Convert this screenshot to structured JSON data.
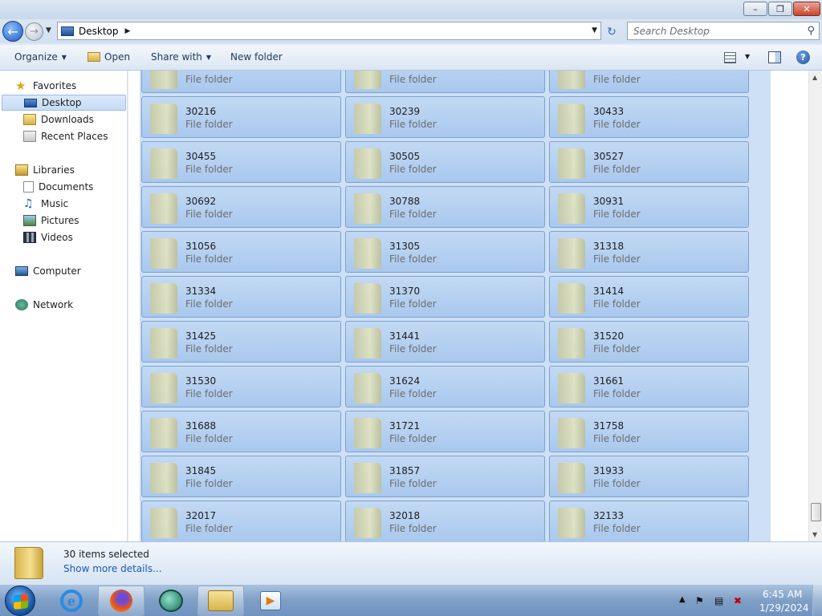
{
  "window": {
    "minimize_icon": "minimize-icon",
    "maximize_icon": "restore-icon",
    "close_icon": "close-icon"
  },
  "address": {
    "location": "Desktop",
    "search_placeholder": "Search Desktop"
  },
  "toolbar": {
    "organize": "Organize",
    "open": "Open",
    "share_with": "Share with",
    "new_folder": "New folder"
  },
  "nav": {
    "favorites": "Favorites",
    "desktop": "Desktop",
    "downloads": "Downloads",
    "recent_places": "Recent Places",
    "libraries": "Libraries",
    "documents": "Documents",
    "music": "Music",
    "pictures": "Pictures",
    "videos": "Videos",
    "computer": "Computer",
    "network": "Network"
  },
  "folder_type_label": "File folder",
  "items": [
    {
      "name": "",
      "type": "File folder"
    },
    {
      "name": "",
      "type": "File folder"
    },
    {
      "name": "",
      "type": "File folder"
    },
    {
      "name": "30216",
      "type": "File folder"
    },
    {
      "name": "30239",
      "type": "File folder"
    },
    {
      "name": "30433",
      "type": "File folder"
    },
    {
      "name": "30455",
      "type": "File folder"
    },
    {
      "name": "30505",
      "type": "File folder"
    },
    {
      "name": "30527",
      "type": "File folder"
    },
    {
      "name": "30692",
      "type": "File folder"
    },
    {
      "name": "30788",
      "type": "File folder"
    },
    {
      "name": "30931",
      "type": "File folder"
    },
    {
      "name": "31056",
      "type": "File folder"
    },
    {
      "name": "31305",
      "type": "File folder"
    },
    {
      "name": "31318",
      "type": "File folder"
    },
    {
      "name": "31334",
      "type": "File folder"
    },
    {
      "name": "31370",
      "type": "File folder"
    },
    {
      "name": "31414",
      "type": "File folder"
    },
    {
      "name": "31425",
      "type": "File folder"
    },
    {
      "name": "31441",
      "type": "File folder"
    },
    {
      "name": "31520",
      "type": "File folder"
    },
    {
      "name": "31530",
      "type": "File folder"
    },
    {
      "name": "31624",
      "type": "File folder"
    },
    {
      "name": "31661",
      "type": "File folder"
    },
    {
      "name": "31688",
      "type": "File folder"
    },
    {
      "name": "31721",
      "type": "File folder"
    },
    {
      "name": "31758",
      "type": "File folder"
    },
    {
      "name": "31845",
      "type": "File folder"
    },
    {
      "name": "31857",
      "type": "File folder"
    },
    {
      "name": "31933",
      "type": "File folder"
    },
    {
      "name": "32017",
      "type": "File folder"
    },
    {
      "name": "32018",
      "type": "File folder"
    },
    {
      "name": "32133",
      "type": "File folder"
    }
  ],
  "details": {
    "selection_count": "30 items selected",
    "more_link": "Show more details..."
  },
  "taskbar": {
    "time": "6:45 AM",
    "date": "1/29/2024"
  }
}
